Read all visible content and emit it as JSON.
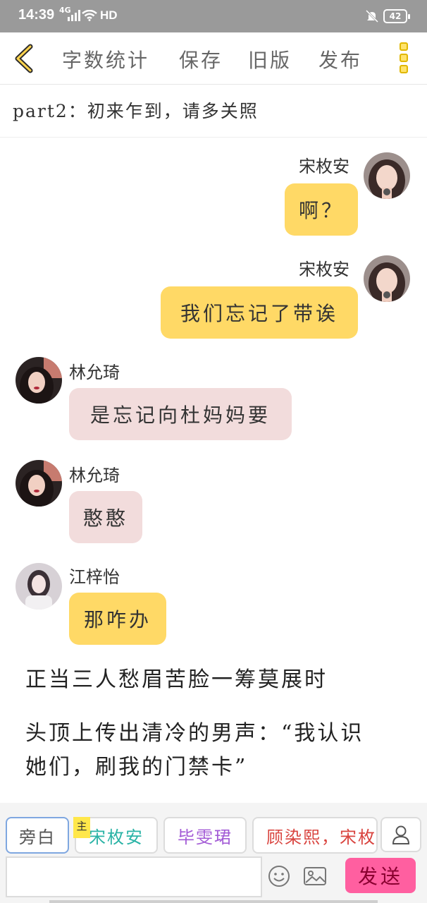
{
  "status_bar": {
    "time": "14:39",
    "network": "4G",
    "hd": "HD",
    "battery": "42"
  },
  "toolbar": {
    "word_count": "字数统计",
    "save": "保存",
    "old_version": "旧版",
    "publish": "发布"
  },
  "chapter": {
    "title": "part2：初来乍到，请多关照"
  },
  "messages": [
    {
      "speaker": "宋枚安",
      "text": "啊？",
      "side": "right",
      "bubble_color": "#ffd966"
    },
    {
      "speaker": "宋枚安",
      "text": "我们忘记了带诶",
      "side": "right",
      "bubble_color": "#ffd966"
    },
    {
      "speaker": "林允琦",
      "text": "是忘记向杜妈妈要",
      "side": "left",
      "bubble_color": "#f2dcdc"
    },
    {
      "speaker": "林允琦",
      "text": "憨憨",
      "side": "left",
      "bubble_color": "#f2dcdc"
    },
    {
      "speaker": "江梓怡",
      "text": "那咋办",
      "side": "left",
      "bubble_color": "#ffd966"
    }
  ],
  "narration": [
    "正当三人愁眉苦脸一筹莫展时",
    "头顶上传出清冷的男声：“我认识",
    "她们，刷我的门禁卡”"
  ],
  "composer": {
    "chips": [
      {
        "label": "旁白",
        "color": "#555555"
      },
      {
        "label": "宋枚安",
        "color": "#2ab3a6"
      },
      {
        "label": "毕雯珺",
        "color": "#a35bd6"
      },
      {
        "label": "顾染熙，宋枚",
        "color": "#d9443f"
      }
    ],
    "main_badge": "主",
    "input_value": "",
    "send_label": "发送"
  }
}
